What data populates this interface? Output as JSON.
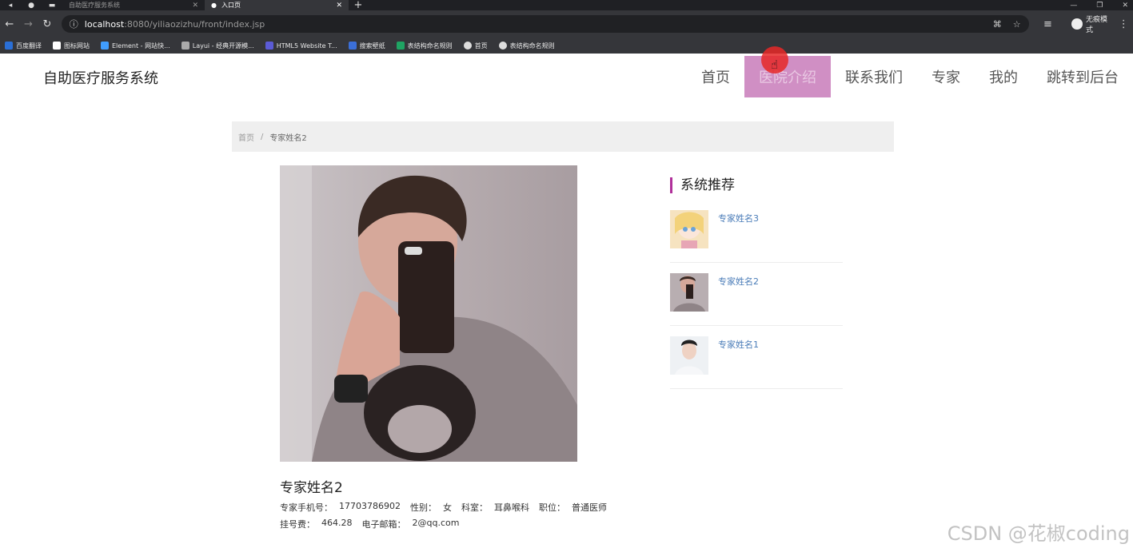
{
  "browser": {
    "tabs": [
      {
        "label": "自助医疗服务系统",
        "active": false
      },
      {
        "label": "入口页",
        "active": true
      }
    ],
    "url_host": "localhost",
    "url_path": ":8080/yiliaozizhu/front/index.jsp",
    "profile_label": "无痕模式",
    "bookmarks": [
      {
        "label": "百度翻译",
        "color": "#2a6fd6"
      },
      {
        "label": "图标网站",
        "color": "#ffffff"
      },
      {
        "label": "Element - 网站快...",
        "color": "#409eff"
      },
      {
        "label": "Layui - 经典开源模...",
        "color": "#cccccc"
      },
      {
        "label": "HTML5 Website T...",
        "color": "#5b5bd6"
      },
      {
        "label": "搜索壁纸",
        "color": "#3b6fd8"
      },
      {
        "label": "表结构命名规则",
        "color": "#1fa463"
      },
      {
        "label": "首页",
        "color": "#dddddd"
      },
      {
        "label": "表结构命名规则",
        "color": "#dddddd"
      }
    ]
  },
  "site": {
    "brand": "自助医疗服务系统",
    "menu": [
      {
        "label": "首页",
        "active": false
      },
      {
        "label": "医院介绍",
        "active": true
      },
      {
        "label": "联系我们",
        "active": false
      },
      {
        "label": "专家",
        "active": false
      },
      {
        "label": "我的",
        "active": false
      },
      {
        "label": "跳转到后台",
        "active": false
      }
    ],
    "accent_color": "#d08fc4"
  },
  "breadcrumb": {
    "home": "首页",
    "separator": "/",
    "current": "专家姓名2"
  },
  "detail": {
    "name": "专家姓名2",
    "phone_label": "专家手机号：",
    "phone": "17703786902",
    "gender_label": "性别：",
    "gender": "女",
    "dept_label": "科室：",
    "dept": "耳鼻喉科",
    "position_label": "职位：",
    "position": "普通医师",
    "fee_label": "挂号费：",
    "fee": "464.28",
    "email_label": "电子邮箱：",
    "email": "2@qq.com"
  },
  "sidebar": {
    "title": "系统推荐",
    "items": [
      {
        "title": "专家姓名3"
      },
      {
        "title": "专家姓名2"
      },
      {
        "title": "专家姓名1"
      }
    ]
  },
  "watermark": "CSDN @花椒coding"
}
